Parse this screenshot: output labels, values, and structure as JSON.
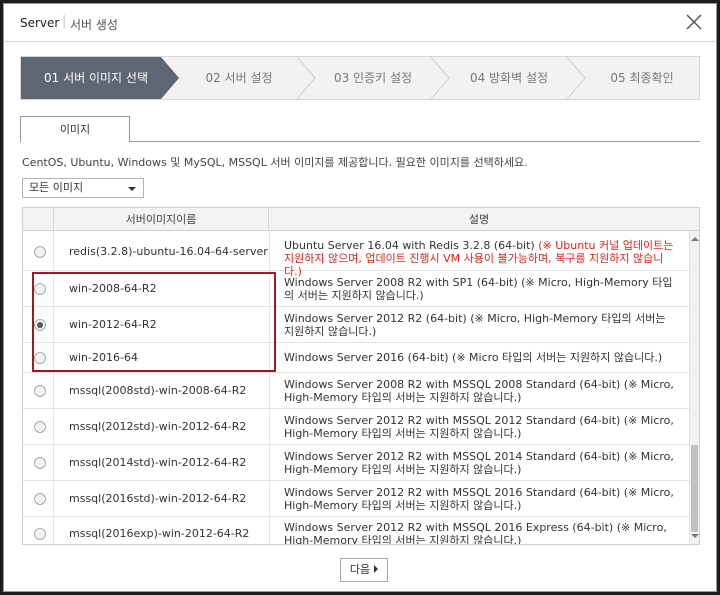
{
  "window": {
    "title": "Server",
    "subtitle": "서버 생성"
  },
  "steps": [
    {
      "label": "01 서버 이미지 선택",
      "active": true
    },
    {
      "label": "02 서버 설정",
      "active": false
    },
    {
      "label": "03 인증키 설정",
      "active": false
    },
    {
      "label": "04 방화벽 설정",
      "active": false
    },
    {
      "label": "05 최종확인",
      "active": false
    }
  ],
  "tab": {
    "label": "이미지"
  },
  "description": "CentOS, Ubuntu, Windows 및 MySQL, MSSQL 서버 이미지를 제공합니다. 필요한 이미지를 선택하세요.",
  "filter": {
    "selected": "모든 이미지"
  },
  "table": {
    "headers": {
      "name": "서버이미지이름",
      "desc": "설명"
    },
    "rows": [
      {
        "name": "redis(3.2.8)-ubuntu-16.04-64-server",
        "desc": "Ubuntu Server 16.04 with Redis 3.2.8 (64-bit) ",
        "warn": "(※ Ubuntu 커널 업데이트는 지원하지 않으며, 업데이트 진행시 VM 사용이 불가능하며, 복구를 지원하지 않습니다.)",
        "selected": false
      },
      {
        "name": "win-2008-64-R2",
        "desc": "Windows Server 2008 R2 with SP1 (64-bit) (※ Micro, High-Memory 타입의 서버는 지원하지 않습니다.)",
        "warn": "",
        "selected": false
      },
      {
        "name": "win-2012-64-R2",
        "desc": "Windows Server 2012 R2 (64-bit) (※ Micro, High-Memory 타입의 서버는 지원하지 않습니다.)",
        "warn": "",
        "selected": true
      },
      {
        "name": "win-2016-64",
        "desc": "Windows Server 2016 (64-bit) (※ Micro 타입의 서버는 지원하지 않습니다.)",
        "warn": "",
        "selected": false
      },
      {
        "name": "mssql(2008std)-win-2008-64-R2",
        "desc": "Windows Server 2008 R2 with MSSQL 2008 Standard (64-bit) (※ Micro, High-Memory 타입의 서버는 지원하지 않습니다.)",
        "warn": "",
        "selected": false
      },
      {
        "name": "mssql(2012std)-win-2012-64-R2",
        "desc": "Windows Server 2012 R2 with MSSQL 2012 Standard (64-bit) (※ Micro, High-Memory 타입의 서버는 지원하지 않습니다.)",
        "warn": "",
        "selected": false
      },
      {
        "name": "mssql(2014std)-win-2012-64-R2",
        "desc": "Windows Server 2012 R2 with MSSQL 2014 Standard (64-bit) (※ Micro, High-Memory 타입의 서버는 지원하지 않습니다.)",
        "warn": "",
        "selected": false
      },
      {
        "name": "mssql(2016std)-win-2012-64-R2",
        "desc": "Windows Server 2012 R2 with MSSQL 2016 Standard (64-bit) (※ Micro, High-Memory 타입의 서버는 지원하지 않습니다.)",
        "warn": "",
        "selected": false
      },
      {
        "name": "mssql(2016exp)-win-2012-64-R2",
        "desc": "Windows Server 2012 R2 with MSSQL 2016 Express (64-bit) (※ Micro, High-Memory 타입의 서버는 지원하지 않습니다.)",
        "warn": "",
        "selected": false
      }
    ]
  },
  "footer": {
    "next_label": "다음"
  },
  "colors": {
    "active_step": "#5e6573",
    "highlight_border": "#9b1b24",
    "warning_text": "#d9241b"
  }
}
